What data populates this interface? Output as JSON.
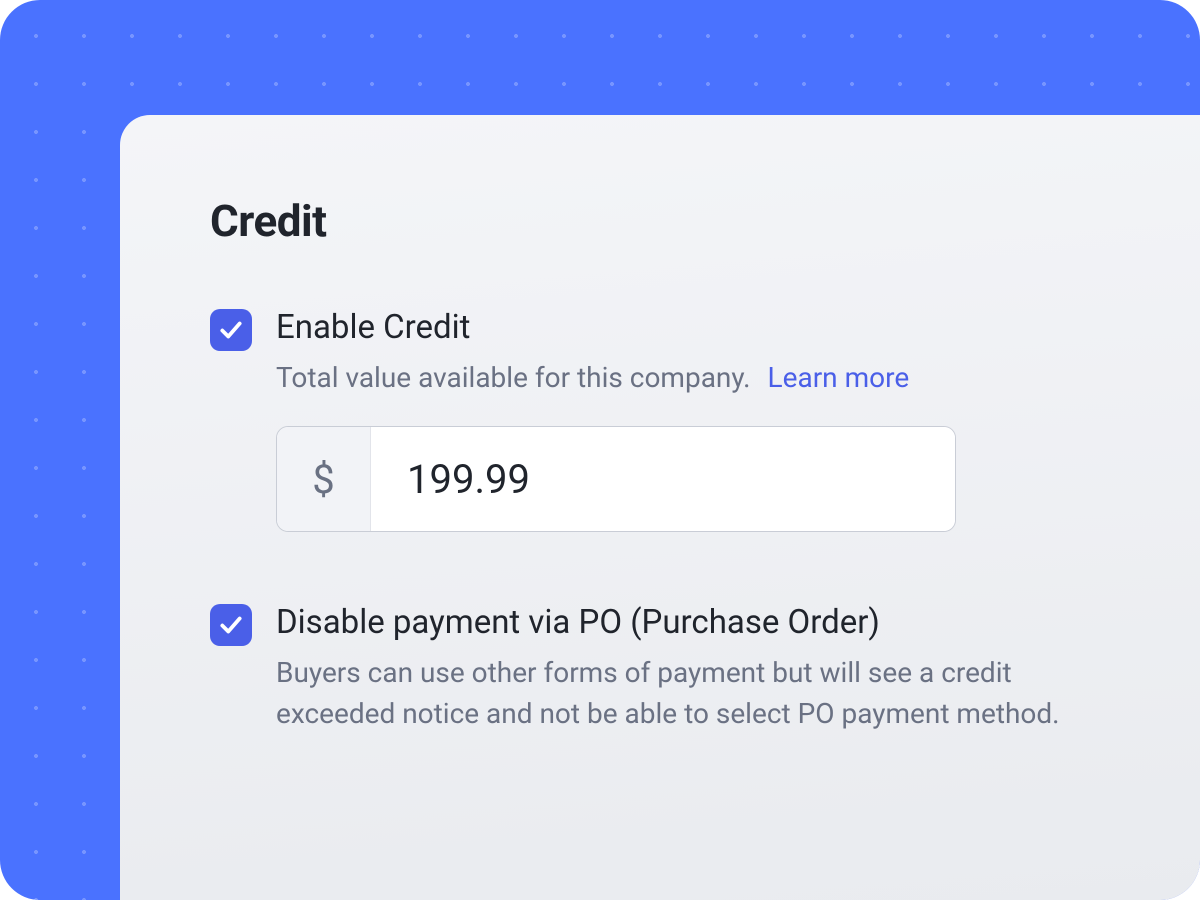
{
  "section": {
    "title": "Credit"
  },
  "options": {
    "enable_credit": {
      "checked": true,
      "label": "Enable Credit",
      "description": "Total value available for this company.",
      "learn_more": "Learn more",
      "currency_symbol": "$",
      "amount": "199.99"
    },
    "disable_po": {
      "checked": true,
      "label": "Disable payment via PO (Purchase Order)",
      "description": "Buyers can  use other forms of payment  but will see a credit exceeded notice and not be able to select PO payment method."
    }
  },
  "colors": {
    "accent": "#4a5fe8",
    "background": "#4a72ff"
  }
}
